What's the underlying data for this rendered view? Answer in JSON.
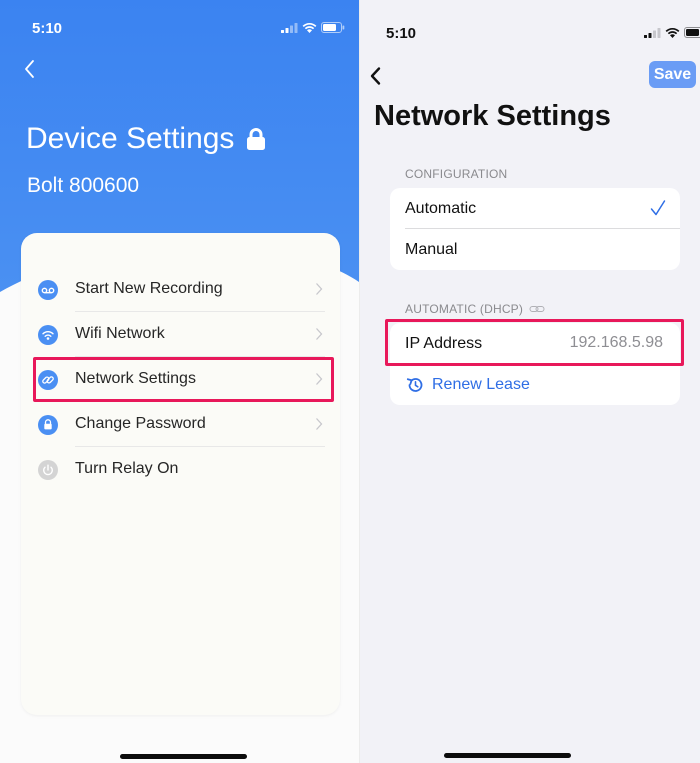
{
  "left": {
    "status_time": "5:10",
    "title": "Device Settings",
    "subtitle": "Bolt 800600",
    "menu": [
      {
        "label": "Start New Recording",
        "icon": "voicemail-icon"
      },
      {
        "label": "Wifi Network",
        "icon": "wifi-icon"
      },
      {
        "label": "Network Settings",
        "icon": "link-icon"
      },
      {
        "label": "Change Password",
        "icon": "lock-icon"
      },
      {
        "label": "Turn Relay On",
        "icon": "power-icon"
      }
    ]
  },
  "right": {
    "status_time": "5:10",
    "save_label": "Save",
    "title": "Network Settings",
    "configuration_header": "CONFIGURATION",
    "config_options": [
      {
        "label": "Automatic",
        "selected": true
      },
      {
        "label": "Manual",
        "selected": false
      }
    ],
    "dhcp_header": "AUTOMATIC (DHCP)",
    "ip_label": "IP Address",
    "ip_value": "192.168.5.98",
    "renew_label": "Renew Lease"
  },
  "colors": {
    "hero_blue": "#3d85f0",
    "accent_blue": "#2f6ee5",
    "highlight": "#e8185a",
    "save_button": "#6a9cf5"
  }
}
